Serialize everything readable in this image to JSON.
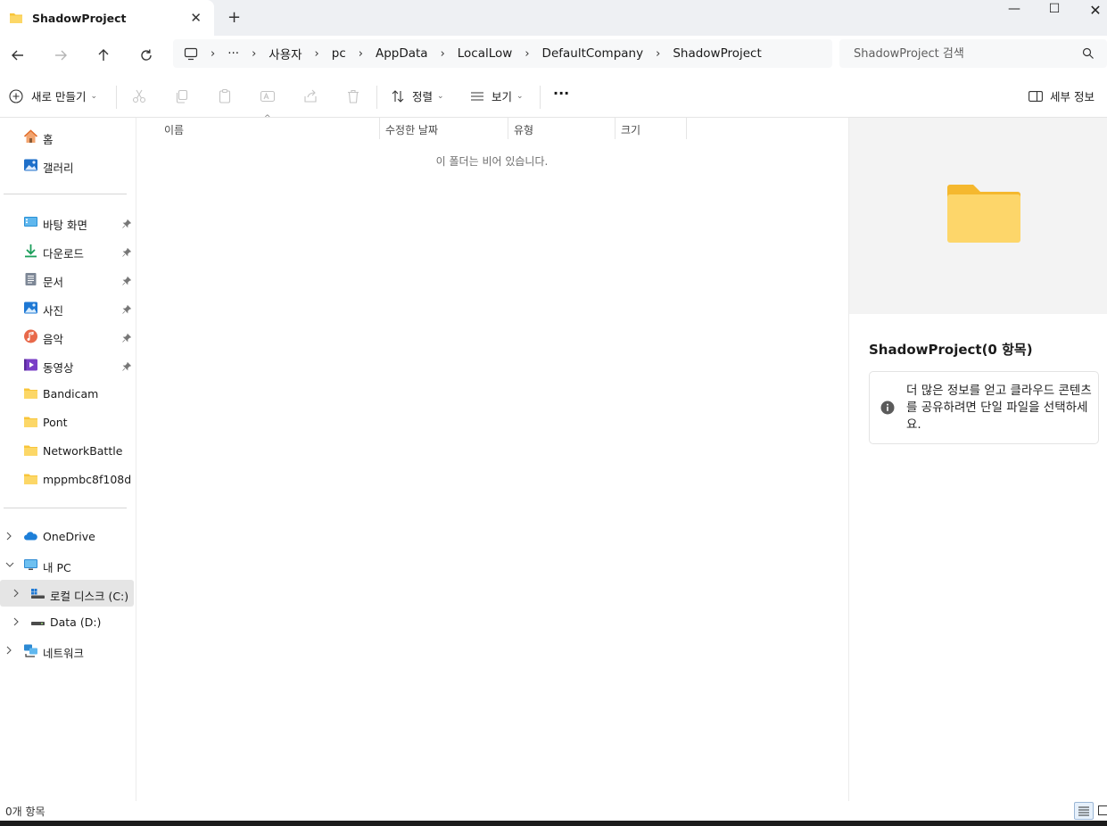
{
  "window": {
    "tab_title": "ShadowProject",
    "new_tab": "+",
    "minimize": "—",
    "maximize": "☐",
    "close": "✕",
    "tab_close": "✕"
  },
  "breadcrumb": {
    "overflow": "···",
    "items": [
      "사용자",
      "pc",
      "AppData",
      "LocalLow",
      "DefaultCompany",
      "ShadowProject"
    ],
    "separator": "›"
  },
  "search": {
    "placeholder": "ShadowProject 검색"
  },
  "toolbar": {
    "new_label": "새로 만들기",
    "sort_label": "정렬",
    "view_label": "보기",
    "more_label": "···",
    "details_label": "세부 정보"
  },
  "sidebar": {
    "home": "홈",
    "gallery": "갤러리",
    "pinned": [
      {
        "label": "바탕 화면",
        "icon": "desktop-icon"
      },
      {
        "label": "다운로드",
        "icon": "download-icon"
      },
      {
        "label": "문서",
        "icon": "documents-icon"
      },
      {
        "label": "사진",
        "icon": "pictures-icon"
      },
      {
        "label": "음악",
        "icon": "music-icon"
      },
      {
        "label": "동영상",
        "icon": "videos-icon"
      }
    ],
    "folders": [
      "Bandicam",
      "Pont",
      "NetworkBattle",
      "mppmbc8f108d"
    ],
    "onedrive": "OneDrive",
    "this_pc": "내 PC",
    "local_disk": "로컬 디스크 (C:)",
    "data_drive": "Data (D:)",
    "network": "네트워크"
  },
  "columns": {
    "name": "이름",
    "modified": "수정한 날짜",
    "type": "유형",
    "size": "크기"
  },
  "main": {
    "empty_message": "이 폴더는 비어 있습니다."
  },
  "details": {
    "title": "ShadowProject(0 항목)",
    "info": "더 많은 정보를 얻고 클라우드 콘텐츠를 공유하려면 단일 파일을 선택하세요."
  },
  "status": {
    "item_count": "0개 항목"
  },
  "colors": {
    "folder_yellow": "#f8c53a",
    "accent_blue": "#0067c0",
    "selected_bg": "#e5e5e5"
  }
}
